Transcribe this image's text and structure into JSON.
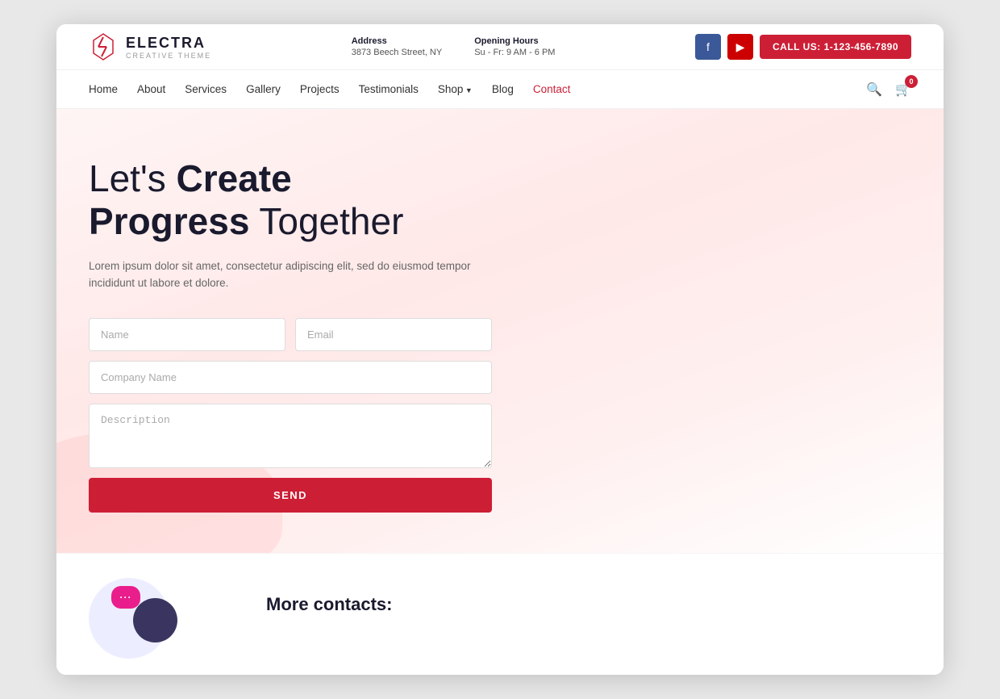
{
  "header": {
    "logo_name": "ELECTRA",
    "logo_sub": "CREATIVE THEME",
    "address_label": "Address",
    "address_value": "3873 Beech Street, NY",
    "hours_label": "Opening Hours",
    "hours_value": "Su - Fr: 9 AM - 6 PM",
    "call_btn": "CALL US: 1-123-456-7890",
    "cart_count": "0"
  },
  "nav": {
    "links": [
      {
        "label": "Home",
        "active": false,
        "has_arrow": false
      },
      {
        "label": "About",
        "active": false,
        "has_arrow": false
      },
      {
        "label": "Services",
        "active": false,
        "has_arrow": false
      },
      {
        "label": "Gallery",
        "active": false,
        "has_arrow": false
      },
      {
        "label": "Projects",
        "active": false,
        "has_arrow": false
      },
      {
        "label": "Testimonials",
        "active": false,
        "has_arrow": false
      },
      {
        "label": "Shop",
        "active": false,
        "has_arrow": true
      },
      {
        "label": "Blog",
        "active": false,
        "has_arrow": false
      },
      {
        "label": "Contact",
        "active": true,
        "has_arrow": false
      }
    ]
  },
  "hero": {
    "title_part1": "Let's ",
    "title_bold1": "Create",
    "title_newline_bold": "Progress",
    "title_part3": " Together",
    "description": "Lorem ipsum dolor sit amet, consectetur adipiscing elit, sed do eiusmod tempor incididunt ut labore et dolore.",
    "form": {
      "name_placeholder": "Name",
      "email_placeholder": "Email",
      "company_placeholder": "Company Name",
      "description_placeholder": "Description",
      "send_label": "SEND"
    }
  },
  "bottom": {
    "more_contacts_title": "More contacts:"
  }
}
